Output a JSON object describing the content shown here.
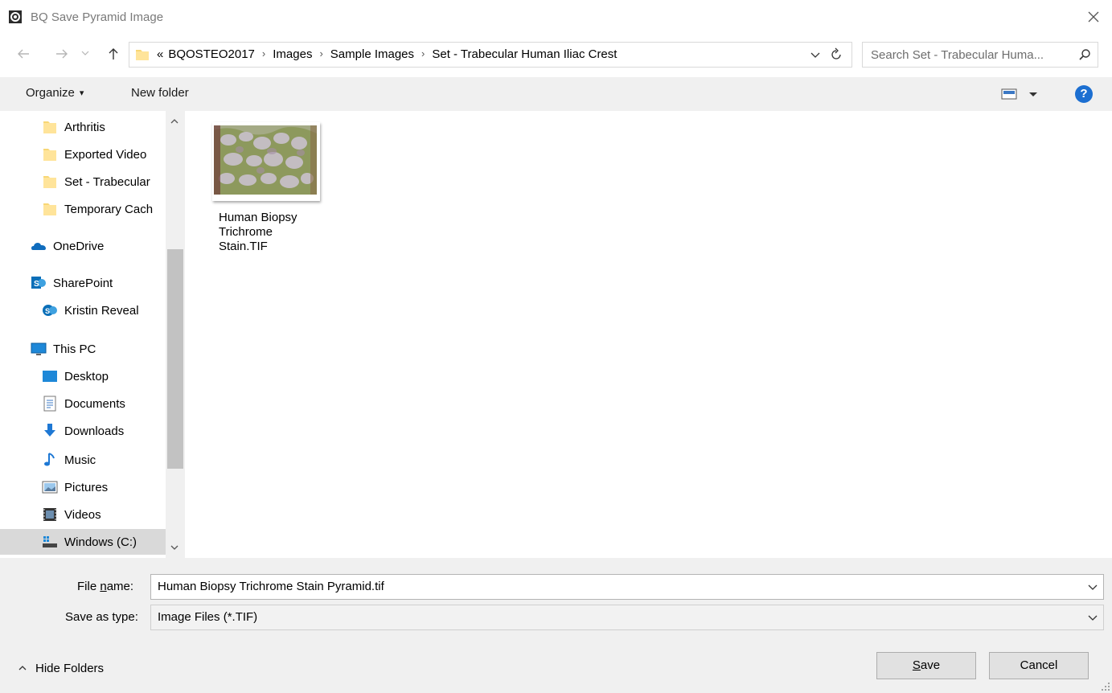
{
  "window": {
    "title": "BQ Save Pyramid Image"
  },
  "address": {
    "overflow": "«",
    "crumbs": [
      "BQOSTEO2017",
      "Images",
      "Sample Images",
      "Set - Trabecular Human Iliac Crest"
    ],
    "separator": "›"
  },
  "search": {
    "placeholder": "Search Set - Trabecular Huma..."
  },
  "toolbar": {
    "organize_label": "Organize",
    "organize_caret": "▾",
    "new_folder_label": "New folder",
    "help_label": "?"
  },
  "nav": {
    "items": [
      {
        "label": "Arthritis",
        "icon": "folder-icon"
      },
      {
        "label": "Exported Video",
        "icon": "folder-icon"
      },
      {
        "label": "Set - Trabecular",
        "icon": "folder-icon"
      },
      {
        "label": "Temporary Cach",
        "icon": "folder-icon"
      },
      {
        "label": "OneDrive",
        "icon": "onedrive-icon"
      },
      {
        "label": "SharePoint",
        "icon": "sharepoint-icon"
      },
      {
        "label": "Kristin Reveal",
        "icon": "sharepoint-site-icon"
      },
      {
        "label": "This PC",
        "icon": "computer-icon"
      },
      {
        "label": "Desktop",
        "icon": "desktop-icon"
      },
      {
        "label": "Documents",
        "icon": "documents-icon"
      },
      {
        "label": "Downloads",
        "icon": "downloads-icon"
      },
      {
        "label": "Music",
        "icon": "music-icon"
      },
      {
        "label": "Pictures",
        "icon": "pictures-icon"
      },
      {
        "label": "Videos",
        "icon": "videos-icon"
      },
      {
        "label": "Windows (C:)",
        "icon": "drive-icon"
      }
    ],
    "selected_index": 14
  },
  "files": [
    {
      "name": "Human Biopsy Trichrome Stain.TIF",
      "icon": "image-thumbnail"
    }
  ],
  "form": {
    "file_name_label_pre": "File ",
    "file_name_label_u": "n",
    "file_name_label_post": "ame:",
    "file_name_value": "Human Biopsy Trichrome Stain Pyramid.tif",
    "save_type_label": "Save as type:",
    "save_type_value": "Image Files (*.TIF)"
  },
  "footer": {
    "hide_folders_label": "Hide Folders",
    "save_label_u": "S",
    "save_label_rest": "ave",
    "cancel_label": "Cancel"
  },
  "colors": {
    "accent": "#1c6fd1",
    "folder": "#f8d775",
    "chrome": "#f0f0f0"
  }
}
